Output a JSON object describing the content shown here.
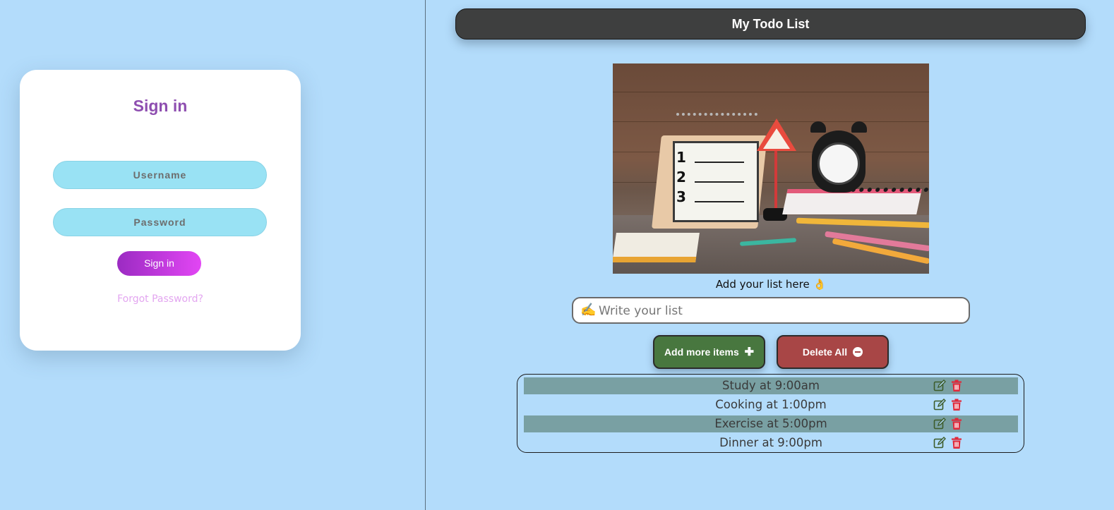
{
  "signin": {
    "title": "Sign in",
    "username_placeholder": "Username",
    "password_placeholder": "Password",
    "button_label": "Sign in",
    "forgot_label": "Forgot Password?"
  },
  "todo": {
    "header_title": "My Todo List",
    "caption": "Add your list here 👌",
    "input_placeholder": "Write your list",
    "input_icon": "✍️",
    "add_button_label": "Add more items",
    "delete_button_label": "Delete All",
    "items": [
      {
        "text": "Study at 9:00am",
        "shaded": true
      },
      {
        "text": "Cooking at 1:00pm",
        "shaded": false
      },
      {
        "text": "Exercise at 5:00pm",
        "shaded": true
      },
      {
        "text": "Dinner at 9:00pm",
        "shaded": false
      }
    ]
  },
  "colors": {
    "background": "#b3dcfb",
    "signin_title": "#8e4eb0",
    "input_fill": "#99e2f4",
    "add_button": "#48773f",
    "delete_button": "#a84646",
    "edit_icon": "#3d5c2a",
    "trash_icon": "#e0283a"
  },
  "hero_image": {
    "pad_numbers": [
      "1",
      "2",
      "3"
    ]
  }
}
